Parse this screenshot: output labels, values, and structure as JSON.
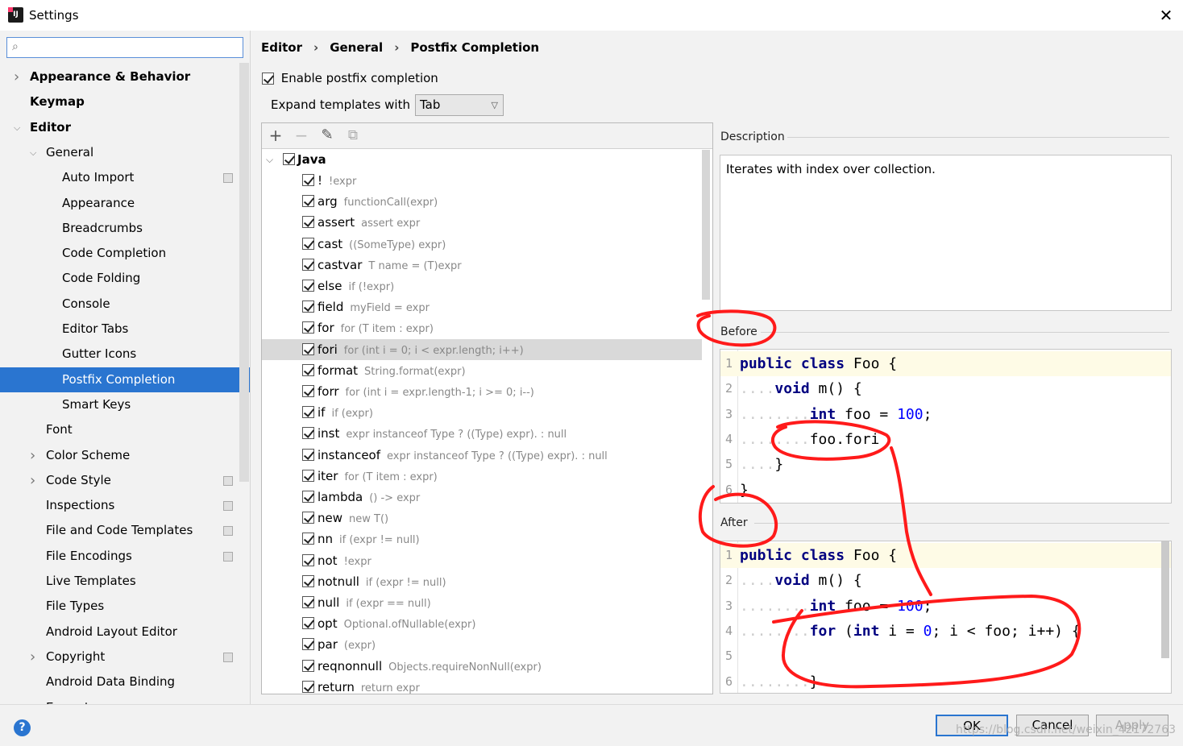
{
  "window": {
    "title": "Settings",
    "close_glyph": "✕"
  },
  "search": {
    "placeholder": ""
  },
  "tree": [
    {
      "label": "Appearance & Behavior",
      "level": 0,
      "bold": true,
      "expand": "collapsed"
    },
    {
      "label": "Keymap",
      "level": 0,
      "bold": true,
      "expand": "none"
    },
    {
      "label": "Editor",
      "level": 0,
      "bold": true,
      "expand": "expanded"
    },
    {
      "label": "General",
      "level": 1,
      "bold": false,
      "expand": "expanded"
    },
    {
      "label": "Auto Import",
      "level": 2,
      "bold": false,
      "expand": "none",
      "project_icon": true
    },
    {
      "label": "Appearance",
      "level": 2,
      "bold": false,
      "expand": "none"
    },
    {
      "label": "Breadcrumbs",
      "level": 2,
      "bold": false,
      "expand": "none"
    },
    {
      "label": "Code Completion",
      "level": 2,
      "bold": false,
      "expand": "none"
    },
    {
      "label": "Code Folding",
      "level": 2,
      "bold": false,
      "expand": "none"
    },
    {
      "label": "Console",
      "level": 2,
      "bold": false,
      "expand": "none"
    },
    {
      "label": "Editor Tabs",
      "level": 2,
      "bold": false,
      "expand": "none"
    },
    {
      "label": "Gutter Icons",
      "level": 2,
      "bold": false,
      "expand": "none"
    },
    {
      "label": "Postfix Completion",
      "level": 2,
      "bold": false,
      "expand": "none",
      "selected": true
    },
    {
      "label": "Smart Keys",
      "level": 2,
      "bold": false,
      "expand": "none"
    },
    {
      "label": "Font",
      "level": 1,
      "bold": false,
      "expand": "none"
    },
    {
      "label": "Color Scheme",
      "level": 1,
      "bold": false,
      "expand": "collapsed"
    },
    {
      "label": "Code Style",
      "level": 1,
      "bold": false,
      "expand": "collapsed",
      "project_icon": true
    },
    {
      "label": "Inspections",
      "level": 1,
      "bold": false,
      "expand": "none",
      "project_icon": true
    },
    {
      "label": "File and Code Templates",
      "level": 1,
      "bold": false,
      "expand": "none",
      "project_icon": true
    },
    {
      "label": "File Encodings",
      "level": 1,
      "bold": false,
      "expand": "none",
      "project_icon": true
    },
    {
      "label": "Live Templates",
      "level": 1,
      "bold": false,
      "expand": "none"
    },
    {
      "label": "File Types",
      "level": 1,
      "bold": false,
      "expand": "none"
    },
    {
      "label": "Android Layout Editor",
      "level": 1,
      "bold": false,
      "expand": "none"
    },
    {
      "label": "Copyright",
      "level": 1,
      "bold": false,
      "expand": "collapsed",
      "project_icon": true
    },
    {
      "label": "Android Data Binding",
      "level": 1,
      "bold": false,
      "expand": "none"
    },
    {
      "label": "Emmet",
      "level": 1,
      "bold": false,
      "expand": "collapsed"
    }
  ],
  "breadcrumb": [
    "Editor",
    "General",
    "Postfix Completion"
  ],
  "enable_postfix": {
    "label": "Enable postfix completion",
    "checked": true
  },
  "expand_templates": {
    "label": "Expand templates with",
    "value": "Tab"
  },
  "toolbar": {
    "add": "+",
    "remove": "−",
    "edit": "✎",
    "copy": "⧉"
  },
  "templates": {
    "group": "Java",
    "items": [
      {
        "key": "!",
        "example": "!expr"
      },
      {
        "key": "arg",
        "example": "functionCall(expr)"
      },
      {
        "key": "assert",
        "example": "assert expr"
      },
      {
        "key": "cast",
        "example": "((SomeType) expr)"
      },
      {
        "key": "castvar",
        "example": "T name = (T)expr"
      },
      {
        "key": "else",
        "example": "if (!expr)"
      },
      {
        "key": "field",
        "example": "myField = expr"
      },
      {
        "key": "for",
        "example": "for (T item : expr)"
      },
      {
        "key": "fori",
        "example": "for (int i = 0; i < expr.length; i++)",
        "highlighted": true
      },
      {
        "key": "format",
        "example": "String.format(expr)"
      },
      {
        "key": "forr",
        "example": "for (int i = expr.length-1; i >= 0; i--)"
      },
      {
        "key": "if",
        "example": "if (expr)"
      },
      {
        "key": "inst",
        "example": "expr instanceof Type ? ((Type) expr). : null"
      },
      {
        "key": "instanceof",
        "example": "expr instanceof Type ? ((Type) expr). : null"
      },
      {
        "key": "iter",
        "example": "for (T item : expr)"
      },
      {
        "key": "lambda",
        "example": "() -> expr"
      },
      {
        "key": "new",
        "example": "new T()"
      },
      {
        "key": "nn",
        "example": "if (expr != null)"
      },
      {
        "key": "not",
        "example": "!expr"
      },
      {
        "key": "notnull",
        "example": "if (expr != null)"
      },
      {
        "key": "null",
        "example": "if (expr == null)"
      },
      {
        "key": "opt",
        "example": "Optional.ofNullable(expr)"
      },
      {
        "key": "par",
        "example": "(expr)"
      },
      {
        "key": "reqnonnull",
        "example": "Objects.requireNonNull(expr)"
      },
      {
        "key": "return",
        "example": "return expr"
      }
    ]
  },
  "description": {
    "label": "Description",
    "text": "Iterates with index over collection."
  },
  "before": {
    "label": "Before",
    "lines": [
      {
        "n": "1",
        "indent": "",
        "tokens": [
          [
            "kw",
            "public"
          ],
          [
            "t",
            " "
          ],
          [
            "kw",
            "class"
          ],
          [
            "t",
            " Foo "
          ],
          [
            "t",
            "{"
          ]
        ]
      },
      {
        "n": "2",
        "indent": "....",
        "tokens": [
          [
            "kw",
            "void"
          ],
          [
            "t",
            " m() {"
          ]
        ]
      },
      {
        "n": "3",
        "indent": "........",
        "tokens": [
          [
            "kw",
            "int"
          ],
          [
            "t",
            " foo = "
          ],
          [
            "num",
            "100"
          ],
          [
            "t",
            ";"
          ]
        ]
      },
      {
        "n": "4",
        "indent": "........",
        "tokens": [
          [
            "t",
            "foo.fori"
          ]
        ]
      },
      {
        "n": "5",
        "indent": "....",
        "tokens": [
          [
            "t",
            "}"
          ]
        ]
      },
      {
        "n": "6",
        "indent": "",
        "tokens": [
          [
            "t",
            "}"
          ]
        ]
      }
    ]
  },
  "after": {
    "label": "After",
    "lines": [
      {
        "n": "1",
        "indent": "",
        "tokens": [
          [
            "kw",
            "public"
          ],
          [
            "t",
            " "
          ],
          [
            "kw",
            "class"
          ],
          [
            "t",
            " Foo "
          ],
          [
            "t",
            "{"
          ]
        ]
      },
      {
        "n": "2",
        "indent": "....",
        "tokens": [
          [
            "kw",
            "void"
          ],
          [
            "t",
            " m() {"
          ]
        ]
      },
      {
        "n": "3",
        "indent": "........",
        "tokens": [
          [
            "kw",
            "int"
          ],
          [
            "t",
            " foo = "
          ],
          [
            "num",
            "100"
          ],
          [
            "t",
            ";"
          ]
        ]
      },
      {
        "n": "4",
        "indent": "........",
        "tokens": [
          [
            "kw",
            "for"
          ],
          [
            "t",
            " ("
          ],
          [
            "kw",
            "int"
          ],
          [
            "t",
            " i = "
          ],
          [
            "num",
            "0"
          ],
          [
            "t",
            "; i < foo; i++) {"
          ]
        ]
      },
      {
        "n": "5",
        "indent": "",
        "tokens": []
      },
      {
        "n": "6",
        "indent": "........",
        "tokens": [
          [
            "t",
            "}"
          ]
        ]
      }
    ]
  },
  "buttons": {
    "help": "?",
    "ok": "OK",
    "cancel": "Cancel",
    "apply": "Apply"
  },
  "watermark": "https://blog.csdn.net/weixin_42172763",
  "colors": {
    "selection": "#2a75d0",
    "annotation": "#ff1a1a",
    "keyword": "#000080",
    "number": "#0000ff"
  }
}
